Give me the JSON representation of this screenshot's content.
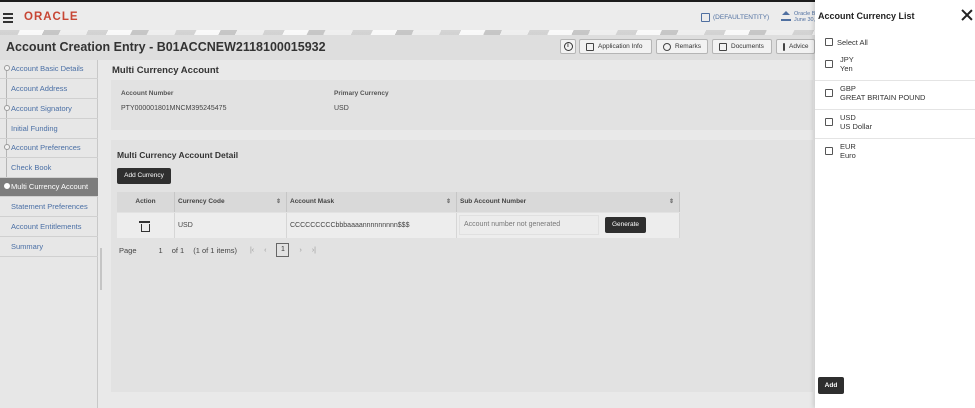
{
  "header": {
    "logo": "ORACLE",
    "entity": "(DEFAULTENTITY)",
    "org_line1": "Oracle B",
    "org_line2": "June 30,"
  },
  "titlebar": {
    "title": "Account Creation Entry - B01ACCNEW2118100015932",
    "buttons": [
      "Application Info",
      "Remarks",
      "Documents",
      "Advice"
    ]
  },
  "sidebar": {
    "items": [
      {
        "label": "Account Basic Details"
      },
      {
        "label": "Account Address"
      },
      {
        "label": "Account Signatory"
      },
      {
        "label": "Initial Funding"
      },
      {
        "label": "Account Preferences"
      },
      {
        "label": "Check Book"
      },
      {
        "label": "Multi Currency Account"
      },
      {
        "label": "Statement Preferences"
      },
      {
        "label": "Account Entitlements"
      },
      {
        "label": "Summary"
      }
    ]
  },
  "main": {
    "title": "Multi Currency Account",
    "account_number_label": "Account Number",
    "account_number_value": "PTY000001801MNCM395245475",
    "primary_currency_label": "Primary Currency",
    "primary_currency_value": "USD",
    "detail_title": "Multi Currency Account Detail",
    "add_currency_label": "Add Currency",
    "table": {
      "headers": [
        "Action",
        "Currency Code",
        "Account Mask",
        "Sub Account Number"
      ],
      "row": {
        "currency_code": "USD",
        "account_mask": "CCCCCCCCCbbbaaaannnnnnnnn$$$",
        "sub_account_placeholder": "Account number not generated",
        "generate_label": "Generate"
      }
    },
    "pager": {
      "page_label": "Page",
      "page_value": "1",
      "of_label": "of 1",
      "items_label": "(1 of 1 items)",
      "current": "1"
    }
  },
  "panel": {
    "title": "Account Currency List",
    "select_all": "Select All",
    "currencies": [
      {
        "code": "JPY",
        "name": "Yen"
      },
      {
        "code": "GBP",
        "name": "GREAT BRITAIN POUND"
      },
      {
        "code": "USD",
        "name": "US Dollar"
      },
      {
        "code": "EUR",
        "name": "Euro"
      }
    ],
    "add_label": "Add"
  }
}
